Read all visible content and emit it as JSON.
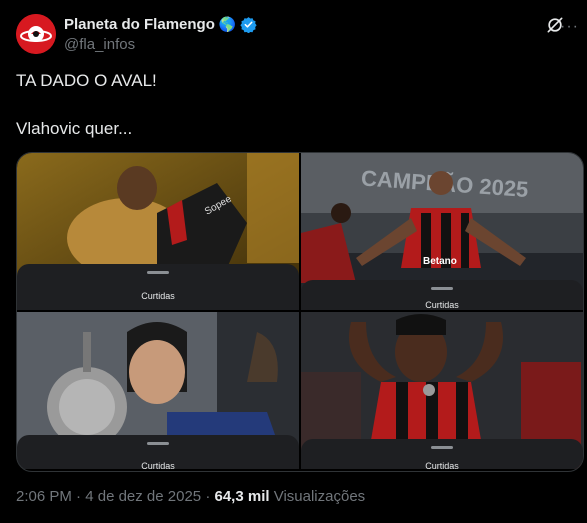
{
  "author": {
    "name": "Planeta do Flamengo",
    "emoji": "🌎",
    "handle": "@fla_infos",
    "verified": true
  },
  "post": {
    "line1": "TA DADO O AVAL!",
    "line2": "Vlahovic quer..."
  },
  "media": [
    {
      "caption": "Curtidas",
      "description": "player-hugging-trophy"
    },
    {
      "caption": "Curtidas",
      "description": "campeao-2025-celebration",
      "banner_text": "CAMPEÃO 2025"
    },
    {
      "caption": "Curtidas",
      "description": "player-kissing-trophy"
    },
    {
      "caption": "Curtidas",
      "description": "player-celebrating-medal"
    }
  ],
  "meta": {
    "time": "2:06 PM",
    "separator": "·",
    "date": "4 de dez de 2025",
    "views_count": "64,3 mil",
    "views_label": "Visualizações"
  },
  "colors": {
    "background": "#000000",
    "verified": "#1d9bf0",
    "flamengo_red": "#c8102e",
    "muted_text": "#71767b"
  }
}
